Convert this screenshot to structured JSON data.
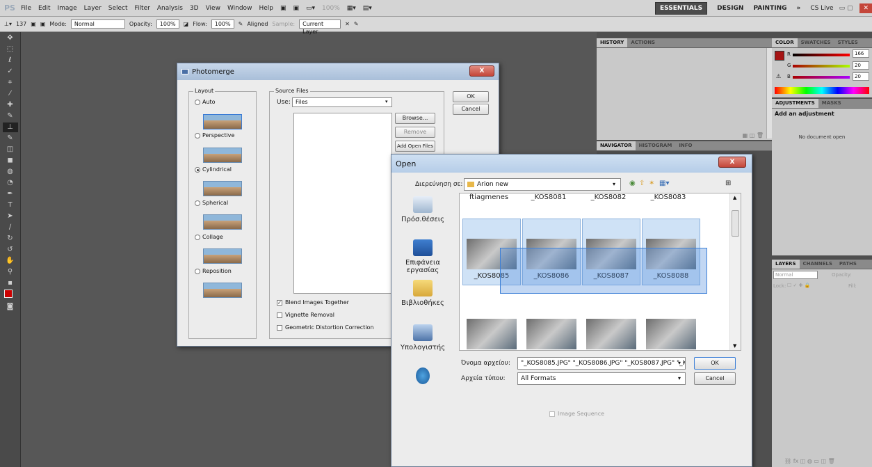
{
  "menubar": {
    "logo": "PS",
    "items": [
      "File",
      "Edit",
      "Image",
      "Layer",
      "Select",
      "Filter",
      "Analysis",
      "3D",
      "View",
      "Window",
      "Help"
    ],
    "zoom": "100%",
    "workspaces": {
      "essentials": "ESSENTIALS",
      "design": "DESIGN",
      "painting": "PAINTING",
      "more": "»",
      "cslive": "CS Live"
    }
  },
  "options": {
    "brush_size": "137",
    "mode_label": "Mode:",
    "mode": "Normal",
    "opacity_label": "Opacity:",
    "opacity": "100%",
    "flow_label": "Flow:",
    "flow": "100%",
    "aligned": "Aligned",
    "sample_label": "Sample:",
    "sample": "Current Layer"
  },
  "history": {
    "tabs": [
      "HISTORY",
      "ACTIONS"
    ]
  },
  "navigator": {
    "tabs": [
      "NAVIGATOR",
      "HISTOGRAM",
      "INFO"
    ]
  },
  "color": {
    "tabs": [
      "COLOR",
      "SWATCHES",
      "STYLES"
    ],
    "r_label": "R",
    "r": "166",
    "g_label": "G",
    "g": "20",
    "b_label": "B",
    "b": "20",
    "swatch": "#a61414"
  },
  "adjustments": {
    "tabs": [
      "ADJUSTMENTS",
      "MASKS"
    ],
    "title": "Add an adjustment",
    "empty": "No document open"
  },
  "layers": {
    "tabs": [
      "LAYERS",
      "CHANNELS",
      "PATHS"
    ],
    "blend": "Normal",
    "opacity_label": "Opacity:",
    "lock_label": "Lock:",
    "fill_label": "Fill:"
  },
  "photomerge": {
    "title": "Photomerge",
    "close": "X",
    "layout_legend": "Layout",
    "options": [
      {
        "label": "Auto",
        "checked": false
      },
      {
        "label": "Perspective",
        "checked": false
      },
      {
        "label": "Cylindrical",
        "checked": true
      },
      {
        "label": "Spherical",
        "checked": false
      },
      {
        "label": "Collage",
        "checked": false
      },
      {
        "label": "Reposition",
        "checked": false
      }
    ],
    "source_legend": "Source Files",
    "use_label": "Use:",
    "use_value": "Files",
    "browse": "Browse...",
    "remove": "Remove",
    "add_open": "Add Open Files",
    "ok": "OK",
    "cancel": "Cancel",
    "blend": "Blend Images Together",
    "vignette": "Vignette Removal",
    "geometric": "Geometric Distortion Correction"
  },
  "open": {
    "title": "Open",
    "close": "X",
    "lookin_label": "Διερεύνηση σε:",
    "lookin_value": "Arion new",
    "places": [
      "Πρόσ.θέσεις",
      "Επιφάνεια εργασίας",
      "Βιβλιοθήκες",
      "Υπολογιστής"
    ],
    "top_items": [
      "ftiagmenes",
      "_KOS8081",
      "_KOS8082",
      "_KOS8083"
    ],
    "files": [
      "_KOS8085",
      "_KOS8086",
      "_KOS8087",
      "_KOS8088"
    ],
    "filename_label": "Όνομα αρχείου:",
    "filename_value": "\"_KOS8085.JPG\" \"_KOS8086.JPG\" \"_KOS8087.JPG\" \"_K(",
    "filetype_label": "Αρχεία τύπου:",
    "filetype_value": "All Formats",
    "ok": "OK",
    "cancel": "Cancel",
    "sequence": "Image Sequence"
  }
}
